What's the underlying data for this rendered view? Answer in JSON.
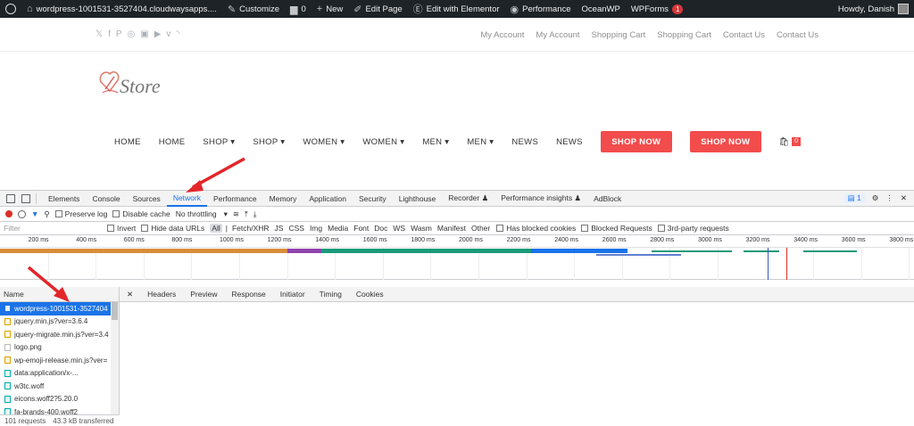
{
  "admin_bar": {
    "site": "wordpress-1001531-3527404.cloudwaysapps....",
    "customize": "Customize",
    "comments": "0",
    "new": "New",
    "edit_page": "Edit Page",
    "elementor": "Edit with Elementor",
    "performance": "Performance",
    "oceanwp": "OceanWP",
    "wpforms": "WPForms",
    "wpforms_count": "1",
    "howdy": "Howdy, Danish"
  },
  "top_links": [
    "My Account",
    "My Account",
    "Shopping Cart",
    "Shopping Cart",
    "Contact Us",
    "Contact Us"
  ],
  "social_icons": [
    "twitter-icon",
    "facebook-icon",
    "pinterest-icon",
    "dribbble-icon",
    "instagram-icon",
    "youtube-icon",
    "vimeo-icon",
    "rss-icon"
  ],
  "logo": {
    "word": "Store"
  },
  "nav": {
    "items": [
      {
        "label": "HOME",
        "caret": false
      },
      {
        "label": "HOME",
        "caret": false
      },
      {
        "label": "SHOP",
        "caret": true
      },
      {
        "label": "SHOP",
        "caret": true
      },
      {
        "label": "WOMEN",
        "caret": true
      },
      {
        "label": "WOMEN",
        "caret": true
      },
      {
        "label": "MEN",
        "caret": true
      },
      {
        "label": "MEN",
        "caret": true
      },
      {
        "label": "NEWS",
        "caret": false
      },
      {
        "label": "NEWS",
        "caret": false
      }
    ],
    "buttons": [
      "SHOP NOW",
      "SHOP NOW"
    ],
    "cart_count": "0"
  },
  "devtools": {
    "tabs": [
      "Elements",
      "Console",
      "Sources",
      "Network",
      "Performance",
      "Memory",
      "Application",
      "Security",
      "Lighthouse",
      "Recorder ♟",
      "Performance insights ♟",
      "AdBlock"
    ],
    "active_tab": "Network",
    "message_count": "1",
    "toolbar": {
      "preserve_log": "Preserve log",
      "disable_cache": "Disable cache",
      "throttling": "No throttling"
    },
    "filter": {
      "placeholder": "Filter",
      "invert": "Invert",
      "hide_data_urls": "Hide data URLs",
      "types": [
        "All",
        "Fetch/XHR",
        "JS",
        "CSS",
        "Img",
        "Media",
        "Font",
        "Doc",
        "WS",
        "Wasm",
        "Manifest",
        "Other"
      ],
      "has_blocked_cookies": "Has blocked cookies",
      "blocked_requests": "Blocked Requests",
      "third_party": "3rd-party requests"
    },
    "timeline_ticks": [
      "200 ms",
      "400 ms",
      "600 ms",
      "800 ms",
      "1000 ms",
      "1200 ms",
      "1400 ms",
      "1600 ms",
      "1800 ms",
      "2000 ms",
      "2200 ms",
      "2400 ms",
      "2600 ms",
      "2800 ms",
      "3000 ms",
      "3200 ms",
      "3400 ms",
      "3600 ms",
      "3800 ms"
    ],
    "name_header": "Name",
    "requests": [
      {
        "name": "wordpress-1001531-3527404",
        "type": "doc"
      },
      {
        "name": "jquery.min.js?ver=3.6.4",
        "type": "js"
      },
      {
        "name": "jquery-migrate.min.js?ver=3.4",
        "type": "js"
      },
      {
        "name": "logo.png",
        "type": "img"
      },
      {
        "name": "wp-emoji-release.min.js?ver=",
        "type": "js"
      },
      {
        "name": "data:application/x-...",
        "type": "font"
      },
      {
        "name": "w3tc.woff",
        "type": "font"
      },
      {
        "name": "eicons.woff2?5.20.0",
        "type": "font"
      },
      {
        "name": "fa-brands-400.woff2",
        "type": "font"
      }
    ],
    "detail_tabs": [
      "Headers",
      "Preview",
      "Response",
      "Initiator",
      "Timing",
      "Cookies"
    ],
    "status": {
      "requests": "101 requests",
      "transferred": "43.3 kB transferred"
    }
  },
  "colors": {
    "accent": "#f24c4c",
    "devtools_blue": "#1a73e8",
    "admin_bar": "#1d2327",
    "annotation": "#e3262a"
  }
}
